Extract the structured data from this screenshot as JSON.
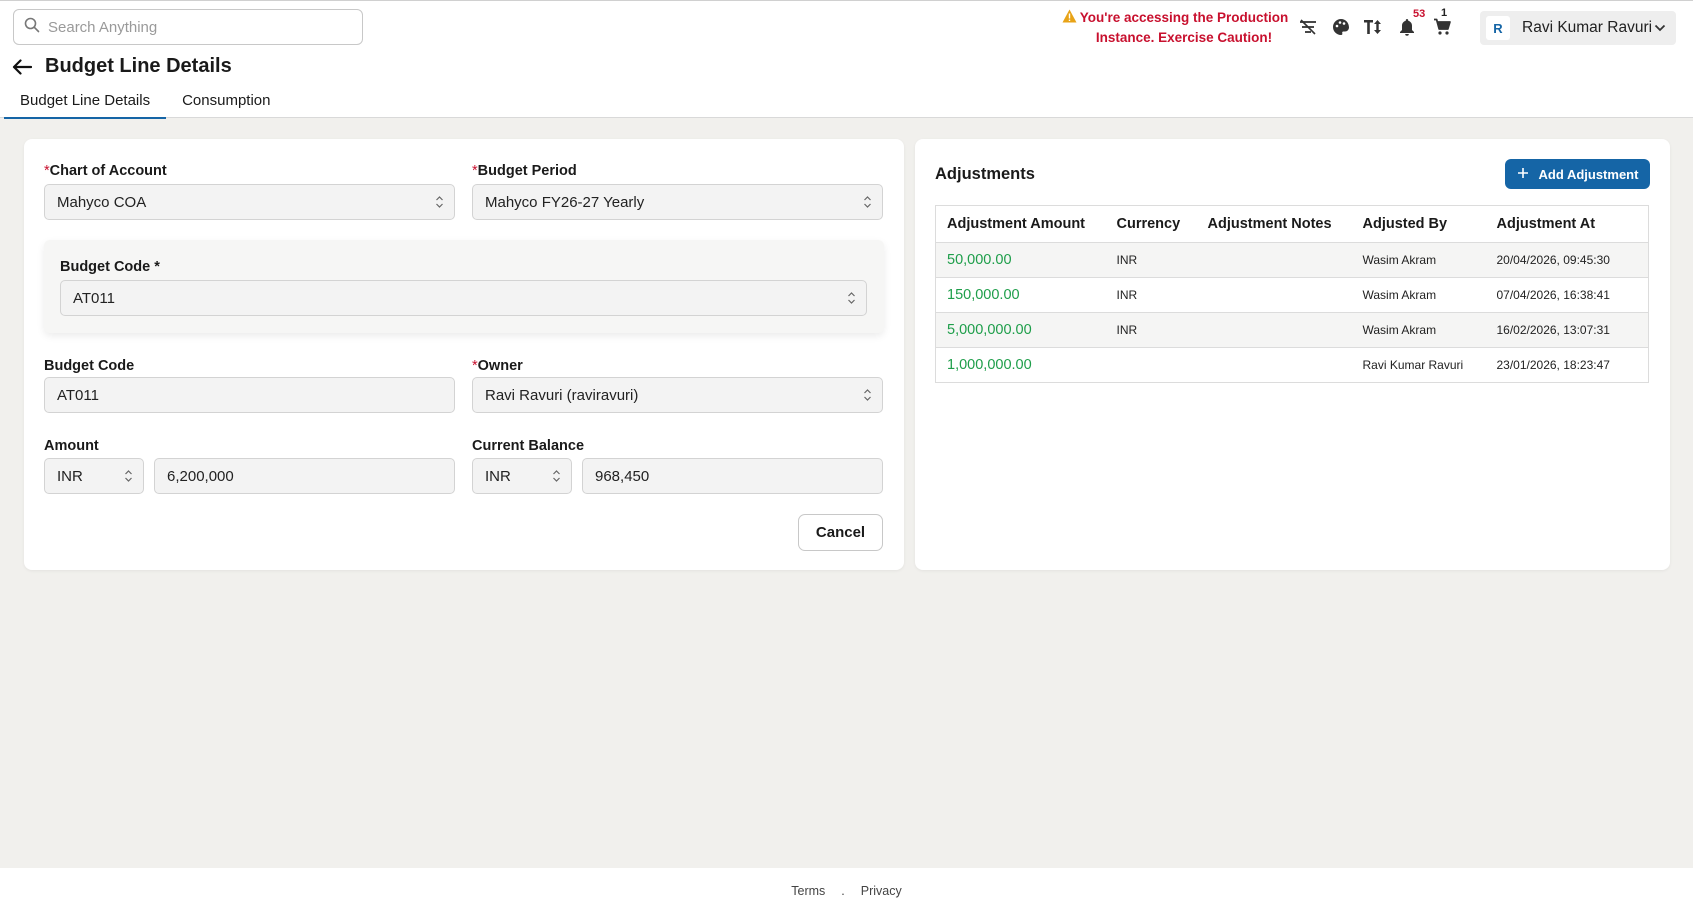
{
  "search": {
    "placeholder": "Search Anything"
  },
  "warning": {
    "text": "You're accessing the Production Instance. Exercise Caution!"
  },
  "header": {
    "notifications_count": "53",
    "cart_count": "1",
    "user": {
      "initial": "R",
      "name": "Ravi Kumar Ravuri"
    }
  },
  "page": {
    "title": "Budget Line Details"
  },
  "tabs": [
    {
      "label": "Budget Line Details",
      "active": true
    },
    {
      "label": "Consumption",
      "active": false
    }
  ],
  "form": {
    "chart_of_account": {
      "label": "Chart of Account",
      "value": "Mahyco COA"
    },
    "budget_period": {
      "label": "Budget Period",
      "value": "Mahyco FY26-27 Yearly"
    },
    "budget_code_select": {
      "label": "Budget Code *",
      "value": "AT011"
    },
    "budget_code": {
      "label": "Budget Code",
      "value": "AT011"
    },
    "owner": {
      "label": "Owner",
      "value": "Ravi Ravuri (raviravuri)"
    },
    "amount": {
      "label": "Amount",
      "currency": "INR",
      "value": "6,200,000"
    },
    "current_balance": {
      "label": "Current Balance",
      "currency": "INR",
      "value": "968,450"
    },
    "cancel_label": "Cancel"
  },
  "adjustments": {
    "title": "Adjustments",
    "add_label": "Add Adjustment",
    "columns": [
      "Adjustment Amount",
      "Currency",
      "Adjustment Notes",
      "Adjusted By",
      "Adjustment At"
    ],
    "rows": [
      {
        "amount": "50,000.00",
        "currency": "INR",
        "notes": "",
        "by": "Wasim Akram",
        "at": "20/04/2026, 09:45:30"
      },
      {
        "amount": "150,000.00",
        "currency": "INR",
        "notes": "",
        "by": "Wasim Akram",
        "at": "07/04/2026, 16:38:41"
      },
      {
        "amount": "5,000,000.00",
        "currency": "INR",
        "notes": "",
        "by": "Wasim Akram",
        "at": "16/02/2026, 13:07:31"
      },
      {
        "amount": "1,000,000.00",
        "currency": "",
        "notes": "",
        "by": "Ravi Kumar Ravuri",
        "at": "23/01/2026, 18:23:47"
      }
    ]
  },
  "footer": {
    "terms": "Terms",
    "separator": ".",
    "privacy": "Privacy"
  },
  "colors": {
    "accent": "#1565a6",
    "warning": "#c8102e",
    "amount_green": "#1e9e4a"
  }
}
